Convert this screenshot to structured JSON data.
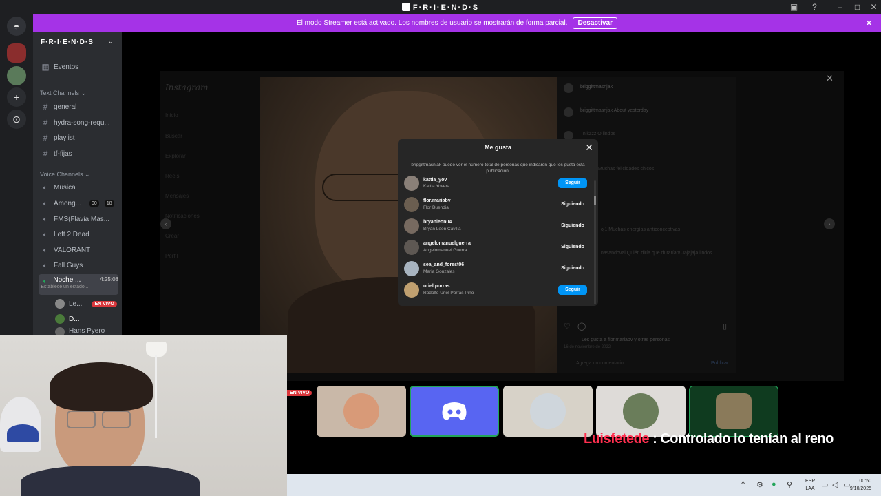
{
  "window": {
    "title": "F·R·I·E·N·D·S"
  },
  "banner": {
    "message": "El modo Streamer está activado. Los nombres de usuario se mostrarán de forma parcial.",
    "button": "Desactivar",
    "color": "#a533e7"
  },
  "sidebar": {
    "server_name": "F·R·I·E·N·D·S",
    "events": "Eventos",
    "text_category": "Text Channels",
    "text_channels": [
      "general",
      "hydra-song-requ...",
      "playlist",
      "tf-fijas"
    ],
    "voice_category": "Voice Channels",
    "voice_channels": [
      {
        "name": "Musica"
      },
      {
        "name": "Among...",
        "badge1": "00",
        "badge2": "18"
      },
      {
        "name": "FMS(Flavia Mas..."
      },
      {
        "name": "Left 2 Dead"
      },
      {
        "name": "VALORANT"
      },
      {
        "name": "Fall Guys"
      }
    ],
    "active_channel": {
      "name": "Noche ...",
      "time": "4:25:08",
      "status": "Establece un estado..."
    },
    "members": [
      {
        "name": "Le...",
        "live": "EN VIVO"
      },
      {
        "name": "D..."
      },
      {
        "name": "Hans Pyero"
      }
    ]
  },
  "instagram": {
    "logo": "Instagram",
    "nav": [
      "Inicio",
      "Buscar",
      "Explorar",
      "Reels",
      "Mensajes",
      "Notificaciones",
      "Crear",
      "Perfil"
    ],
    "post_user": "briggittmasnjak",
    "caption": "briggittmasnjak About yesterday",
    "comments": [
      "_nikzzz O lindos",
      "Muchas felicidades chicos",
      "oj1 Muchas energías anticonceptivas",
      "nasandoval Quién diría que durarían! Jajajaja lindos"
    ],
    "likes_text": "Les gusta a flor.mariabv y otras personas",
    "date": "16 de noviembre de 2022",
    "add_comment": "Agrega un comentario...",
    "publish": "Publicar"
  },
  "likes_modal": {
    "title": "Me gusta",
    "note": "briggittmasnjak puede ver el número total de personas que indicaron que les gusta esta publicación.",
    "rows": [
      {
        "user": "kattia_yov",
        "name": "Kattia Yovera",
        "action": "Seguir",
        "style": "blue"
      },
      {
        "user": "flor.mariabv",
        "name": "Flor Buendia",
        "action": "Siguiendo",
        "style": "grey"
      },
      {
        "user": "bryanleon04",
        "name": "Bryan Leon Cavilia",
        "action": "Siguiendo",
        "style": "grey"
      },
      {
        "user": "angelomanuelguerra",
        "name": "Angelomanuel Guerra",
        "action": "Siguiendo",
        "style": "grey"
      },
      {
        "user": "sea_and_forest06",
        "name": "Maria Gonzales",
        "action": "Siguiendo",
        "style": "grey"
      },
      {
        "user": "uriel.porras",
        "name": "Rodolfo Uriel Porras Pino",
        "action": "Seguir",
        "style": "blue"
      }
    ]
  },
  "tiles": {
    "live_tag": "EN VIVO"
  },
  "chat": {
    "user": "Luisfetede",
    "message": " : Controlado lo tenían al reno"
  },
  "taskbar": {
    "lang": "ESP",
    "lang2": "LAA",
    "time": "00:50",
    "date": "9/10/2025"
  }
}
